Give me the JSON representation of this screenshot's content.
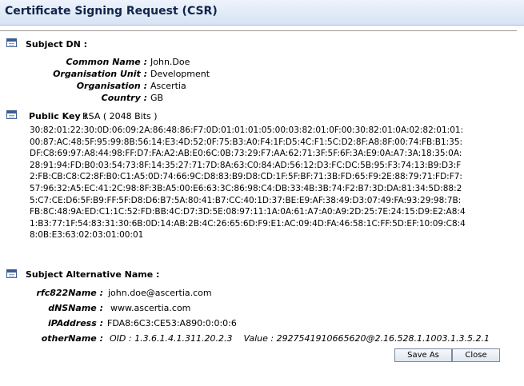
{
  "window": {
    "title": "Certificate Signing Request (CSR)"
  },
  "subject_dn": {
    "heading": "Subject DN :",
    "fields": [
      {
        "label": "Common Name :",
        "value": "John.Doe"
      },
      {
        "label": "Organisation Unit :",
        "value": "Development"
      },
      {
        "label": "Organisation :",
        "value": "Ascertia"
      },
      {
        "label": "Country :",
        "value": "GB"
      }
    ]
  },
  "public_key": {
    "label": "Public Key :",
    "summary": "RSA ( 2048 Bits )",
    "hex": "30:82:01:22:30:0D:06:09:2A:86:48:86:F7:0D:01:01:01:05:00:03:82:01:0F:00:30:82:01:0A:02:82:01:01:00:87:AC:48:5F:95:99:8B:56:14:E3:4D:52:0F:75:B3:A0:F4:1F:D5:4C:F1:5C:D2:8F:A8:8F:00:74:FB:B1:35:DF:C8:69:97:A8:44:98:FF:D7:FA:A2:AB:E0:6C:0B:73:29:F7:AA:62:71:3F:5F:6F:3A:E9:0A:A7:3A:18:35:0A:28:91:94:FD:B0:03:54:73:8F:14:35:27:71:7D:8A:63:C0:84:AD:56:12:D3:FC:DC:5B:95:F3:74:13:B9:D3:F2:FB:CB:C8:C2:8F:B0:C1:A5:0D:74:66:9C:D8:83:B9:D8:CD:1F:5F:BF:71:3B:FD:65:F9:2E:88:79:71:FD:F7:57:96:32:A5:EC:41:2C:98:8F:3B:A5:00:E6:63:3C:86:98:C4:DB:33:4B:3B:74:F2:B7:3D:DA:81:34:5D:88:25:C7:CE:D6:5F:B9:FF:5F:D8:D6:B7:5A:80:41:B7:CC:40:1D:37:BE:E9:AF:38:49:D3:07:49:FA:93:29:98:7B:FB:8C:48:9A:ED:C1:1C:52:FD:BB:4C:D7:3D:5E:08:97:11:1A:0A:61:A7:A0:A9:2D:25:7E:24:15:D9:E2:A8:41:B3:77:1F:54:83:31:30:6B:0D:14:AB:2B:4C:26:65:6D:F9:E1:AC:09:4D:FA:46:58:1C:FF:5D:EF:10:09:C8:48:0B:E3:63:02:03:01:00:01"
  },
  "subject_alt_name": {
    "heading": "Subject Alternative Name :",
    "fields": [
      {
        "label": "rfc822Name :",
        "value": "john.doe@ascertia.com"
      },
      {
        "label": "dNSName :",
        "value": "www.ascertia.com"
      },
      {
        "label": "iPAddress :",
        "value": "FDA8:6C3:CE53:A890:0:0:0:6"
      },
      {
        "label": "otherName :",
        "value": "OID : 1.3.6.1.4.1.311.20.2.3    Value : 2927541910665620@2.16.528.1.1003.1.3.5.2.1"
      }
    ]
  },
  "buttons": {
    "save_as": "Save As",
    "close": "Close"
  }
}
